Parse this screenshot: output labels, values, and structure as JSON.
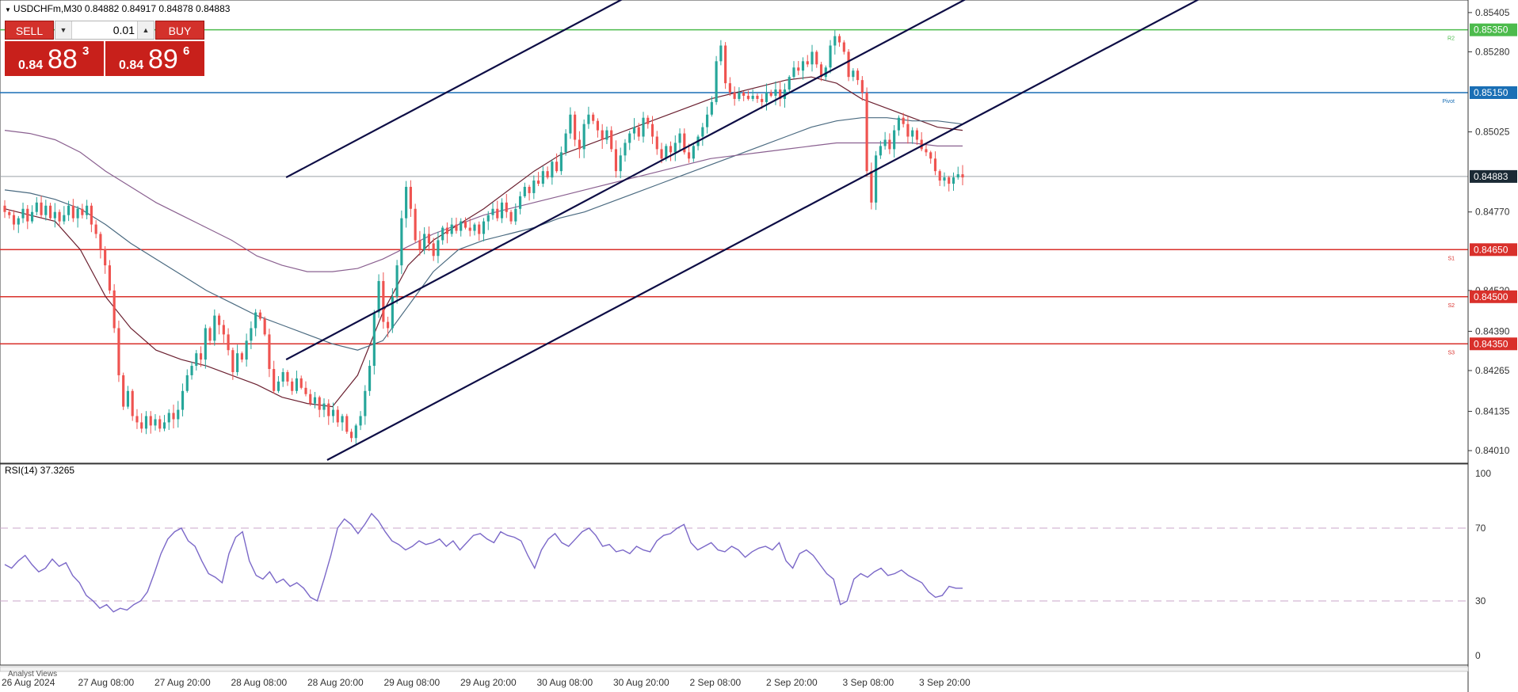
{
  "window": {
    "symbol_line": "USDCHFm,M30  0.84882 0.84917 0.84878 0.84883"
  },
  "trade_panel": {
    "sell_label": "SELL",
    "buy_label": "BUY",
    "lot_value": "0.01",
    "sell_quote": {
      "small": "0.84",
      "big": "88",
      "sup": "3"
    },
    "buy_quote": {
      "small": "0.84",
      "big": "89",
      "sup": "6"
    }
  },
  "footer": {
    "analyst_views": "Analyst Views"
  },
  "colors": {
    "bull": "#26a69a",
    "bear": "#ef5350",
    "resistance": "#4cbb4c",
    "pivot": "#1a6fb5",
    "support": "#d9302b",
    "channel": "#0d0d45",
    "ma_fast": "#6b2030",
    "ma_mid": "#4a6a80",
    "ma_slow": "#8a6090",
    "rsi": "#7b68c8",
    "price_tag": "#1b2a35"
  },
  "chart_data": [
    {
      "type": "candlestick",
      "symbol": "USDCHFm",
      "timeframe": "M30",
      "ohlc_header": {
        "open": 0.84882,
        "high": 0.84917,
        "low": 0.84878,
        "close": 0.84883
      },
      "current_price": 0.84883,
      "current_price_label": "0.84883",
      "y_ticks": [
        "0.85405",
        "0.85280",
        "0.85025",
        "0.84770",
        "0.84520",
        "0.84390",
        "0.84265",
        "0.84135",
        "0.84010"
      ],
      "ylim": [
        0.8397,
        0.85445
      ],
      "x_ticks": [
        "26 Aug 2024",
        "27 Aug 08:00",
        "27 Aug 20:00",
        "28 Aug 08:00",
        "28 Aug 20:00",
        "29 Aug 08:00",
        "29 Aug 20:00",
        "30 Aug 08:00",
        "30 Aug 20:00",
        "2 Sep 08:00",
        "2 Sep 20:00",
        "3 Sep 08:00",
        "3 Sep 20:00"
      ],
      "levels": [
        {
          "name": "R2",
          "value": 0.8535,
          "price_label": "0.85350"
        },
        {
          "name": "Pivot",
          "value": 0.8515,
          "price_label": "0.85150"
        },
        {
          "name": "S1",
          "value": 0.8465,
          "price_label": "0.84650"
        },
        {
          "name": "S2",
          "value": 0.845,
          "price_label": "0.84500"
        },
        {
          "name": "S3",
          "value": 0.8435,
          "price_label": "0.84350"
        }
      ],
      "closes": [
        0.8477,
        0.8476,
        0.8473,
        0.8475,
        0.8478,
        0.8474,
        0.8477,
        0.848,
        0.8476,
        0.8479,
        0.8475,
        0.8477,
        0.8474,
        0.8476,
        0.8479,
        0.8475,
        0.8478,
        0.8476,
        0.8479,
        0.8473,
        0.847,
        0.8465,
        0.846,
        0.8452,
        0.844,
        0.8425,
        0.8415,
        0.842,
        0.8412,
        0.841,
        0.8408,
        0.8412,
        0.8409,
        0.8411,
        0.8408,
        0.841,
        0.8413,
        0.8411,
        0.8414,
        0.842,
        0.8425,
        0.8428,
        0.8432,
        0.843,
        0.844,
        0.8436,
        0.8444,
        0.8441,
        0.8438,
        0.8433,
        0.8426,
        0.8432,
        0.843,
        0.8436,
        0.844,
        0.8445,
        0.8443,
        0.8438,
        0.8427,
        0.842,
        0.8423,
        0.8426,
        0.8423,
        0.842,
        0.8424,
        0.8421,
        0.8419,
        0.8416,
        0.8418,
        0.8414,
        0.8416,
        0.8412,
        0.8414,
        0.841,
        0.8412,
        0.8407,
        0.8405,
        0.8409,
        0.8412,
        0.842,
        0.8428,
        0.8445,
        0.8455,
        0.8442,
        0.844,
        0.845,
        0.846,
        0.8475,
        0.8485,
        0.8478,
        0.8468,
        0.8465,
        0.847,
        0.8467,
        0.8463,
        0.8468,
        0.8472,
        0.847,
        0.8473,
        0.8471,
        0.8474,
        0.8472,
        0.8471,
        0.8473,
        0.847,
        0.8474,
        0.8476,
        0.8478,
        0.8475,
        0.848,
        0.8477,
        0.8474,
        0.8478,
        0.8482,
        0.8485,
        0.8483,
        0.8487,
        0.8486,
        0.849,
        0.8488,
        0.8493,
        0.849,
        0.8496,
        0.8502,
        0.8508,
        0.85,
        0.8497,
        0.8505,
        0.8508,
        0.8506,
        0.8503,
        0.85,
        0.8503,
        0.8497,
        0.849,
        0.8495,
        0.8499,
        0.8502,
        0.8504,
        0.8501,
        0.8507,
        0.8505,
        0.8501,
        0.8497,
        0.8494,
        0.8498,
        0.8496,
        0.8499,
        0.8502,
        0.8496,
        0.8494,
        0.8498,
        0.8501,
        0.8504,
        0.8508,
        0.8512,
        0.8525,
        0.853,
        0.8518,
        0.8515,
        0.8513,
        0.8515,
        0.8514,
        0.8513,
        0.8514,
        0.8513,
        0.8512,
        0.8515,
        0.8514,
        0.8516,
        0.8513,
        0.8516,
        0.852,
        0.8523,
        0.8522,
        0.8525,
        0.8524,
        0.8528,
        0.8524,
        0.852,
        0.8523,
        0.853,
        0.8533,
        0.8531,
        0.8528,
        0.852,
        0.8522,
        0.8519,
        0.8515,
        0.849,
        0.848,
        0.8495,
        0.8498,
        0.85,
        0.8497,
        0.8503,
        0.8507,
        0.8505,
        0.8501,
        0.8503,
        0.85,
        0.8497,
        0.8496,
        0.8494,
        0.849,
        0.8487,
        0.8488,
        0.8486,
        0.8488,
        0.8489,
        0.8488
      ],
      "moving_averages": [
        {
          "values": [
            0.8478,
            0.8476,
            0.8474,
            0.8465,
            0.845,
            0.844,
            0.8433,
            0.843,
            0.8428,
            0.8425,
            0.8422,
            0.8418,
            0.8416,
            0.8415,
            0.8425,
            0.8445,
            0.846,
            0.8468,
            0.8473,
            0.8478,
            0.8484,
            0.849,
            0.8495,
            0.8498,
            0.8501,
            0.8504,
            0.8507,
            0.851,
            0.8513,
            0.8515,
            0.8517,
            0.8519,
            0.852,
            0.8518,
            0.8513,
            0.851,
            0.8507,
            0.8504,
            0.8503
          ]
        },
        {
          "values": [
            0.8484,
            0.8483,
            0.8481,
            0.8478,
            0.8473,
            0.8467,
            0.8462,
            0.8457,
            0.8452,
            0.8448,
            0.8444,
            0.8441,
            0.8438,
            0.8435,
            0.8433,
            0.8436,
            0.8447,
            0.8458,
            0.8465,
            0.8468,
            0.847,
            0.8472,
            0.8475,
            0.8477,
            0.848,
            0.8483,
            0.8486,
            0.8489,
            0.8492,
            0.8495,
            0.8498,
            0.8501,
            0.8504,
            0.8506,
            0.8507,
            0.8507,
            0.8506,
            0.8506,
            0.8505
          ]
        },
        {
          "values": [
            0.8503,
            0.8502,
            0.85,
            0.8496,
            0.849,
            0.8485,
            0.848,
            0.8476,
            0.8472,
            0.8468,
            0.8463,
            0.846,
            0.8458,
            0.8458,
            0.8459,
            0.8462,
            0.8466,
            0.847,
            0.8473,
            0.8476,
            0.8478,
            0.848,
            0.8482,
            0.8484,
            0.8486,
            0.8488,
            0.849,
            0.8492,
            0.8494,
            0.8495,
            0.8496,
            0.8497,
            0.8498,
            0.8499,
            0.8499,
            0.8499,
            0.8499,
            0.8498,
            0.8498
          ]
        }
      ],
      "channel_lines": [
        {
          "x": [
            0.192,
            0.475
          ],
          "y": [
            0.8488,
            0.8558
          ]
        },
        {
          "x": [
            0.192,
            0.685
          ],
          "y": [
            0.843,
            0.8552
          ]
        },
        {
          "x": [
            0.22,
            0.897
          ],
          "y": [
            0.8398,
            0.8565
          ]
        }
      ]
    },
    {
      "type": "line",
      "title": "RSI(14) 37.3265",
      "ylim": [
        0,
        100
      ],
      "y_ticks": [
        100,
        70,
        30,
        0
      ],
      "reference_lines": [
        70,
        30
      ],
      "values": [
        50,
        48,
        52,
        55,
        50,
        46,
        48,
        53,
        49,
        51,
        44,
        40,
        33,
        30,
        26,
        28,
        24,
        26,
        25,
        28,
        30,
        35,
        45,
        56,
        64,
        68,
        70,
        63,
        60,
        52,
        45,
        43,
        40,
        56,
        65,
        68,
        52,
        44,
        42,
        46,
        40,
        42,
        38,
        40,
        37,
        32,
        30,
        42,
        55,
        70,
        75,
        72,
        67,
        72,
        78,
        74,
        68,
        63,
        61,
        58,
        60,
        63,
        61,
        62,
        64,
        60,
        63,
        58,
        62,
        66,
        67,
        64,
        62,
        68,
        66,
        65,
        63,
        55,
        48,
        58,
        64,
        67,
        62,
        60,
        64,
        68,
        70,
        66,
        60,
        61,
        57,
        58,
        56,
        60,
        58,
        57,
        63,
        66,
        67,
        70,
        72,
        62,
        58,
        60,
        62,
        58,
        57,
        60,
        58,
        54,
        57,
        59,
        60,
        58,
        62,
        52,
        48,
        56,
        58,
        55,
        50,
        45,
        42,
        28,
        30,
        42,
        45,
        43,
        46,
        48,
        44,
        45,
        47,
        44,
        42,
        40,
        35,
        32,
        33,
        38,
        37,
        37
      ]
    }
  ]
}
